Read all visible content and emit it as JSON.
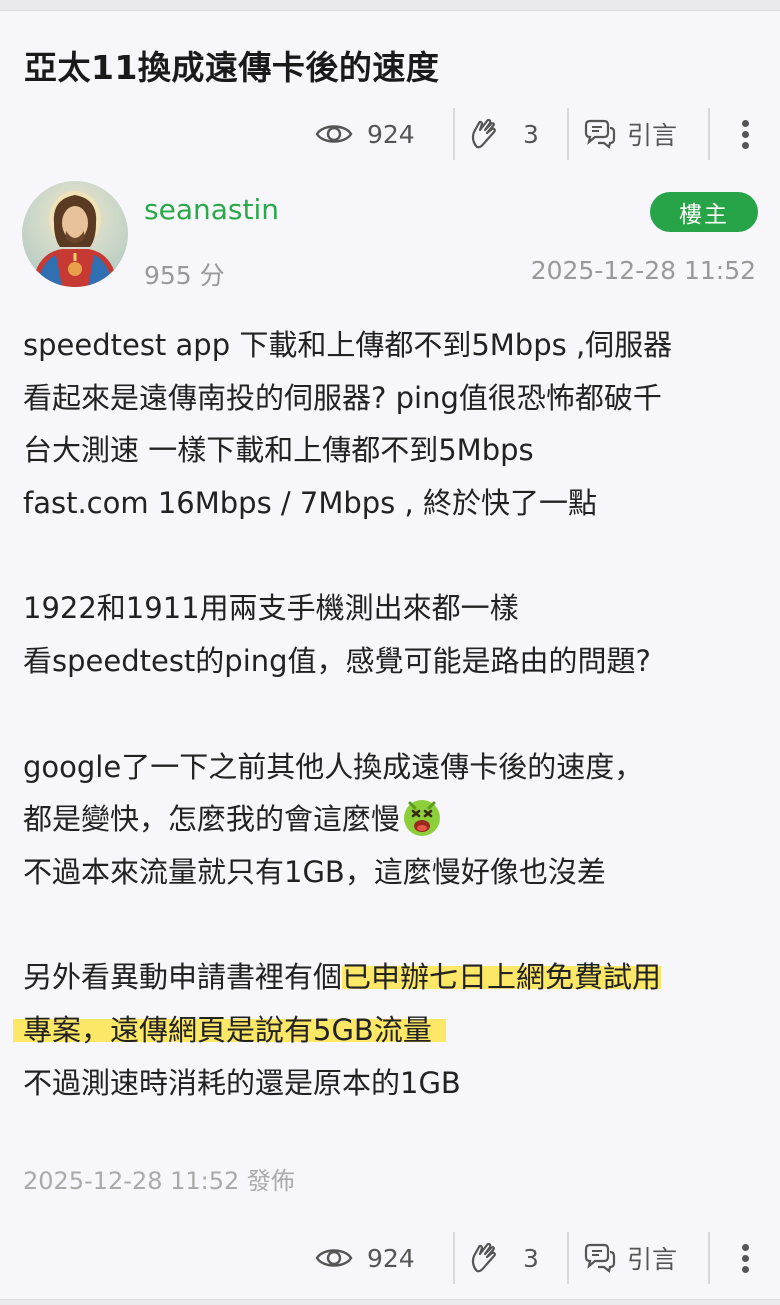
{
  "title": "亞太11換成遠傳卡後的速度",
  "stats": {
    "views": "924",
    "likes": "3",
    "quote_label": "引言"
  },
  "author": {
    "name": "seanastin",
    "score": "955 分",
    "badge": "樓主",
    "post_time": "2025-12-28 11:52"
  },
  "body": {
    "lines": [
      "speedtest app 下載和上傳都不到5Mbps ,伺服器",
      "看起來是遠傳南投的伺服器? ping值很恐怖都破千",
      "台大測速 一樣下載和上傳都不到5Mbps",
      "fast.com 16Mbps / 7Mbps , 終於快了一點",
      "",
      "1922和1911用兩支手機測出來都一樣",
      "看speedtest的ping值，感覺可能是路由的問題?",
      "",
      "google了一下之前其他人換成遠傳卡後的速度，",
      "都是變快，怎麼我的會這麼慢",
      "不過本來流量就只有1GB，這麼慢好像也沒差",
      "",
      "另外看異動申請書裡有個",
      "已申辦七日上網免費試用",
      "專案，遠傳網頁是說有5GB流量",
      "不過測速時消耗的還是原本的1GB"
    ]
  },
  "footer": {
    "published": "2025-12-28 11:52 發佈"
  },
  "colors": {
    "accent_green": "#27a447",
    "highlight": "#fde766"
  },
  "icons": [
    "eye-icon",
    "clap-icon",
    "quote-chat-icon",
    "more-vert-icon",
    "angry-emoji-icon"
  ]
}
